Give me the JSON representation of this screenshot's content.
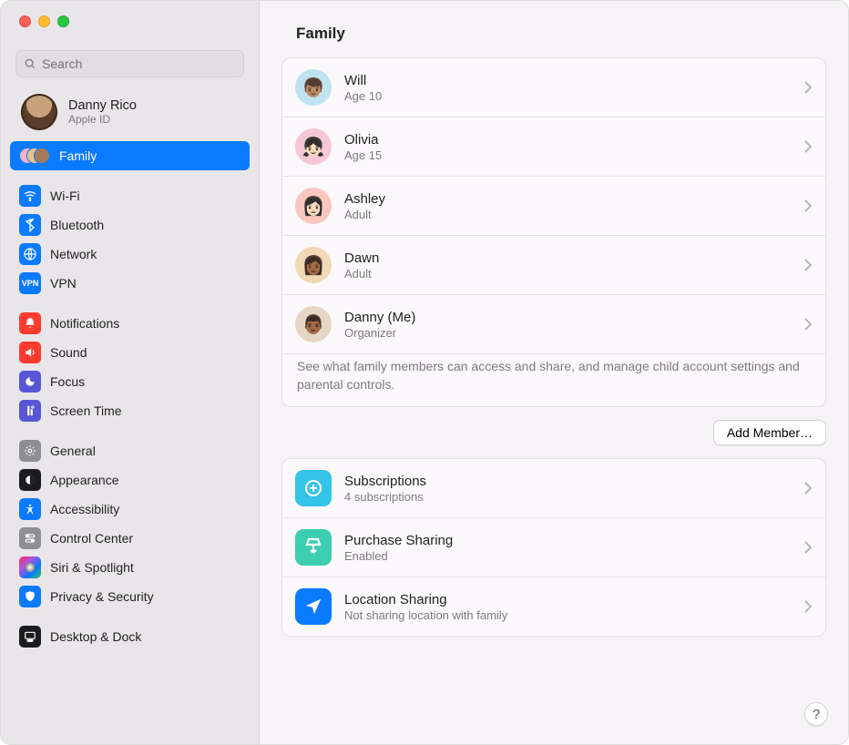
{
  "search": {
    "placeholder": "Search"
  },
  "profile": {
    "name": "Danny Rico",
    "subtitle": "Apple ID"
  },
  "sidebar": {
    "items": [
      {
        "label": "Family",
        "icon": "family-avatars",
        "selected": true
      },
      {
        "gap": true
      },
      {
        "label": "Wi-Fi",
        "icon": "wifi",
        "color": "ic-blue"
      },
      {
        "label": "Bluetooth",
        "icon": "bluetooth",
        "color": "ic-blue"
      },
      {
        "label": "Network",
        "icon": "network",
        "color": "ic-blue"
      },
      {
        "label": "VPN",
        "icon": "vpn",
        "color": "ic-blue"
      },
      {
        "gap": true
      },
      {
        "label": "Notifications",
        "icon": "notifications",
        "color": "ic-red"
      },
      {
        "label": "Sound",
        "icon": "sound",
        "color": "ic-red"
      },
      {
        "label": "Focus",
        "icon": "focus",
        "color": "ic-purple"
      },
      {
        "label": "Screen Time",
        "icon": "screentime",
        "color": "ic-purple"
      },
      {
        "gap": true
      },
      {
        "label": "General",
        "icon": "general",
        "color": "ic-grey"
      },
      {
        "label": "Appearance",
        "icon": "appearance",
        "color": "ic-black"
      },
      {
        "label": "Accessibility",
        "icon": "accessibility",
        "color": "ic-blue"
      },
      {
        "label": "Control Center",
        "icon": "controlcenter",
        "color": "ic-grey"
      },
      {
        "label": "Siri & Spotlight",
        "icon": "siri",
        "color": "ic-grad"
      },
      {
        "label": "Privacy & Security",
        "icon": "privacy",
        "color": "ic-blue"
      },
      {
        "gap": true
      },
      {
        "label": "Desktop & Dock",
        "icon": "desktopdock",
        "color": "ic-black"
      }
    ]
  },
  "main": {
    "title": "Family",
    "members": [
      {
        "name": "Will",
        "sub": "Age 10",
        "bg": "#bfe3f1",
        "emoji": "👦🏽"
      },
      {
        "name": "Olivia",
        "sub": "Age 15",
        "bg": "#f6c7d6",
        "emoji": "👧🏻"
      },
      {
        "name": "Ashley",
        "sub": "Adult",
        "bg": "#f9c7bd",
        "emoji": "👩🏻"
      },
      {
        "name": "Dawn",
        "sub": "Adult",
        "bg": "#f1d9b5",
        "emoji": "👩🏾"
      },
      {
        "name": "Danny (Me)",
        "sub": "Organizer",
        "bg": "#e6d6c6",
        "emoji": "👨🏾"
      }
    ],
    "members_footer": "See what family members can access and share, and manage child account settings and parental controls.",
    "add_member_label": "Add Member…",
    "features": [
      {
        "title": "Subscriptions",
        "sub": "4 subscriptions",
        "icon_bg": "fi-cyan",
        "icon": "subscriptions"
      },
      {
        "title": "Purchase Sharing",
        "sub": "Enabled",
        "icon_bg": "fi-teal",
        "icon": "purchase"
      },
      {
        "title": "Location Sharing",
        "sub": "Not sharing location with family",
        "icon_bg": "fi-blue",
        "icon": "location"
      }
    ],
    "help_label": "?"
  }
}
